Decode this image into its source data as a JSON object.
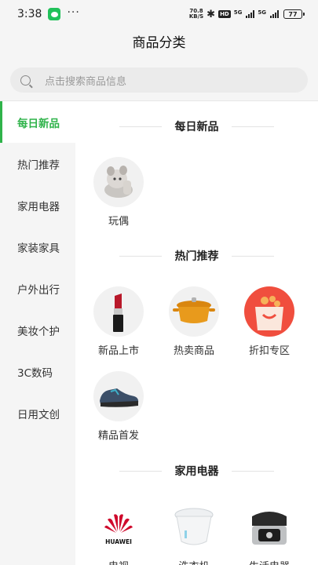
{
  "status": {
    "time": "3:38",
    "speed_top": "70.8",
    "speed_unit": "KB/S",
    "hd": "HD",
    "net1": "5G",
    "net2": "5G",
    "battery": "77",
    "more": "···"
  },
  "header": {
    "title": "商品分类"
  },
  "search": {
    "placeholder": "点击搜索商品信息"
  },
  "sidebar": {
    "items": [
      "每日新品",
      "热门推荐",
      "家用电器",
      "家装家具",
      "户外出行",
      "美妆个护",
      "3C数码",
      "日用文创"
    ],
    "active_index": 0
  },
  "sections": [
    {
      "title": "每日新品",
      "items": [
        {
          "label": "玩偶",
          "icon": "plush-toy-icon"
        }
      ]
    },
    {
      "title": "热门推荐",
      "items": [
        {
          "label": "新品上市",
          "icon": "lipstick-icon"
        },
        {
          "label": "热卖商品",
          "icon": "cast-iron-pot-icon"
        },
        {
          "label": "折扣专区",
          "icon": "shopping-bag-icon"
        },
        {
          "label": "精品首发",
          "icon": "sneaker-icon"
        }
      ]
    },
    {
      "title": "家用电器",
      "items": [
        {
          "label": "电视",
          "icon": "huawei-logo-icon",
          "logo_text": "HUAWEI"
        },
        {
          "label": "洗衣机",
          "icon": "toilet-icon"
        },
        {
          "label": "生活电器",
          "icon": "rice-cooker-icon"
        }
      ]
    }
  ],
  "colors": {
    "accent": "#2fb34a",
    "bag": "#f04e3e",
    "pot": "#e89a1c",
    "huawei": "#cf0a2c"
  }
}
